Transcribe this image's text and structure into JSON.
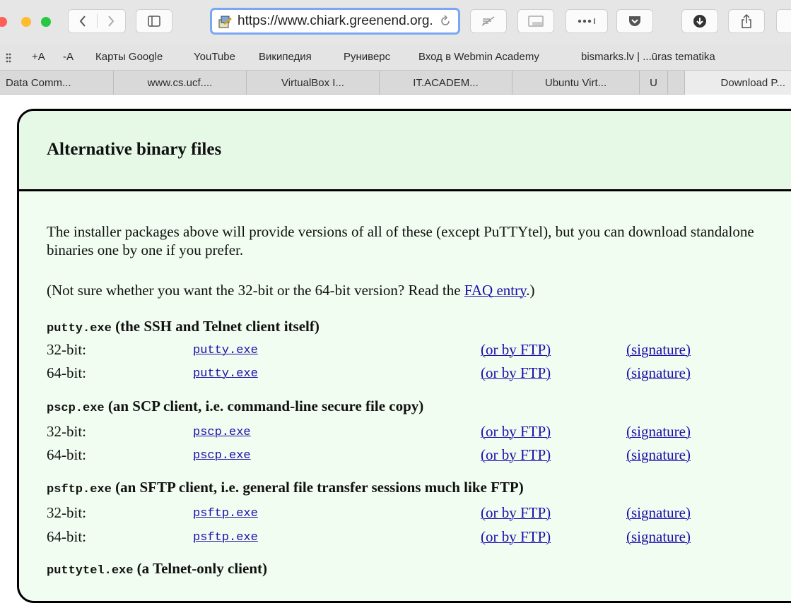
{
  "toolbar": {
    "address": "https://www.chiark.greenend.org.uk/~sgtatham/putty/latest.html",
    "traffic_colors": [
      "#fe5f57",
      "#febc2e",
      "#28c840"
    ]
  },
  "bookmarks": [
    "+A",
    "-A",
    "Карты Google",
    "YouTube",
    "Википедия",
    "Руниверс",
    "Вход в Webmin Academy",
    "bismarks.lv | ...ūras tematika"
  ],
  "tabs": [
    "Data Comm...",
    "www.cs.ucf....",
    "VirtualBox I...",
    "IT.ACADEM...",
    "Ubuntu Virt...",
    "U",
    "",
    "Download P..."
  ],
  "page": {
    "heading": "Alternative binary files",
    "intro": "The installer packages above will provide versions of all of these (except PuTTYtel), but you can download standalone binaries one by one if you prefer.",
    "note_before": "(Not sure whether you want the 32-bit or the 64-bit version? Read the ",
    "note_link": "FAQ entry",
    "note_after": ".)",
    "sections": [
      {
        "file": "putty.exe",
        "desc": " (the SSH and Telnet client itself)",
        "rows": [
          {
            "bits": "32-bit:",
            "file": "putty.exe",
            "ftp": "(or by FTP)",
            "sig": "(signature)"
          },
          {
            "bits": "64-bit:",
            "file": "putty.exe",
            "ftp": "(or by FTP)",
            "sig": "(signature)"
          }
        ]
      },
      {
        "file": "pscp.exe",
        "desc": " (an SCP client, i.e. command-line secure file copy)",
        "rows": [
          {
            "bits": "32-bit:",
            "file": "pscp.exe",
            "ftp": "(or by FTP)",
            "sig": "(signature)"
          },
          {
            "bits": "64-bit:",
            "file": "pscp.exe",
            "ftp": "(or by FTP)",
            "sig": "(signature)"
          }
        ]
      },
      {
        "file": "psftp.exe",
        "desc": " (an SFTP client, i.e. general file transfer sessions much like FTP)",
        "rows": [
          {
            "bits": "32-bit:",
            "file": "psftp.exe",
            "ftp": "(or by FTP)",
            "sig": "(signature)"
          },
          {
            "bits": "64-bit:",
            "file": "psftp.exe",
            "ftp": "(or by FTP)",
            "sig": "(signature)"
          }
        ]
      },
      {
        "file": "puttytel.exe",
        "desc": " (a Telnet-only client)",
        "rows": []
      }
    ]
  },
  "colors": {
    "header_bg": "#e6f9e6",
    "body_bg": "#f0fdf0",
    "link": "#1a0dab",
    "url_focus": "#7aa7f2"
  }
}
